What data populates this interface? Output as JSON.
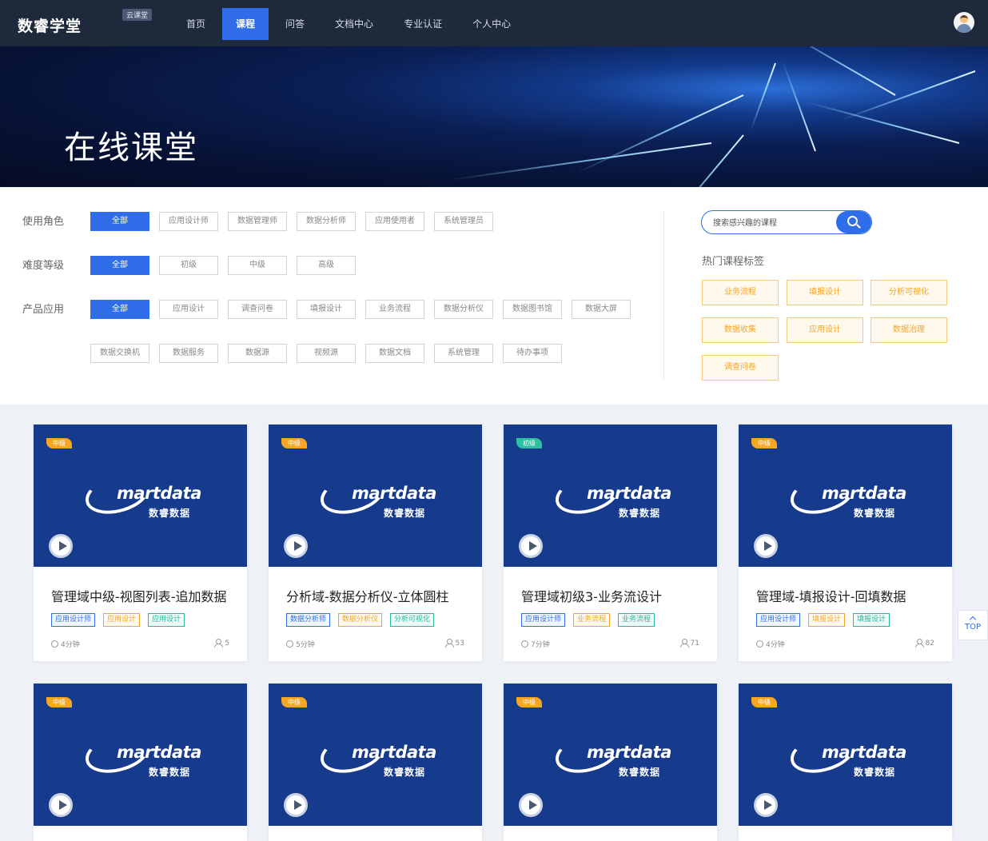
{
  "header": {
    "brand": "数睿学堂",
    "badge": "云课堂",
    "nav": [
      "首页",
      "课程",
      "问答",
      "文档中心",
      "专业认证",
      "个人中心"
    ],
    "active_nav": "课程"
  },
  "banner": {
    "title": "在线课堂"
  },
  "filters": {
    "role": {
      "label": "使用角色",
      "options": [
        "全部",
        "应用设计师",
        "数据管理师",
        "数据分析师",
        "应用使用者",
        "系统管理员"
      ],
      "selected": "全部"
    },
    "level": {
      "label": "难度等级",
      "options": [
        "全部",
        "初级",
        "中级",
        "高级"
      ],
      "selected": "全部"
    },
    "product": {
      "label": "产品应用",
      "options": [
        "全部",
        "应用设计",
        "调查问卷",
        "填报设计",
        "业务流程",
        "数据分析仪",
        "数据图书馆",
        "数据大屏",
        "数据交换机",
        "数据服务",
        "数据源",
        "视频源",
        "数据文档",
        "系统管理",
        "待办事项"
      ],
      "selected": "全部"
    }
  },
  "search": {
    "placeholder": "搜索感兴趣的课程"
  },
  "hot_tags": {
    "title": "热门课程标签",
    "tags": [
      "业务流程",
      "填报设计",
      "分析可视化",
      "数据收集",
      "应用设计",
      "数据治理",
      "调查问卷"
    ]
  },
  "logo": {
    "word": "martdata",
    "sub": "数睿数据"
  },
  "courses": [
    {
      "level": "中级",
      "title": "管理域中级-视图列表-追加数据",
      "tags": [
        {
          "text": "应用设计师",
          "color": "blue"
        },
        {
          "text": "应用设计",
          "color": "orange"
        },
        {
          "text": "应用设计",
          "color": "teal"
        }
      ],
      "duration": "4分钟",
      "learners": "5"
    },
    {
      "level": "中级",
      "title": "分析域-数据分析仪-立体圆柱",
      "tags": [
        {
          "text": "数据分析师",
          "color": "blue"
        },
        {
          "text": "数据分析仪",
          "color": "orange"
        },
        {
          "text": "分析可视化",
          "color": "teal"
        }
      ],
      "duration": "5分钟",
      "learners": "53"
    },
    {
      "level": "初级",
      "title": "管理域初级3-业务流设计",
      "tags": [
        {
          "text": "应用设计师",
          "color": "blue"
        },
        {
          "text": "业务流程",
          "color": "orange"
        },
        {
          "text": "业务流程",
          "color": "teal"
        }
      ],
      "duration": "7分钟",
      "learners": "71"
    },
    {
      "level": "中级",
      "title": "管理域-填报设计-回填数据",
      "tags": [
        {
          "text": "应用设计师",
          "color": "blue"
        },
        {
          "text": "填报设计",
          "color": "orange"
        },
        {
          "text": "填报设计",
          "color": "teal"
        }
      ],
      "duration": "4分钟",
      "learners": "82"
    },
    {
      "level": "中级"
    },
    {
      "level": "中级"
    },
    {
      "level": "中级"
    },
    {
      "level": "中级"
    }
  ],
  "top_button": "TOP",
  "colors": {
    "primary": "#2f6ee8",
    "nav_bg": "#1e2a3c",
    "cover_bg": "#163a8c",
    "tag_orange": "#f5a623",
    "level_green": "#2bc0a4"
  }
}
